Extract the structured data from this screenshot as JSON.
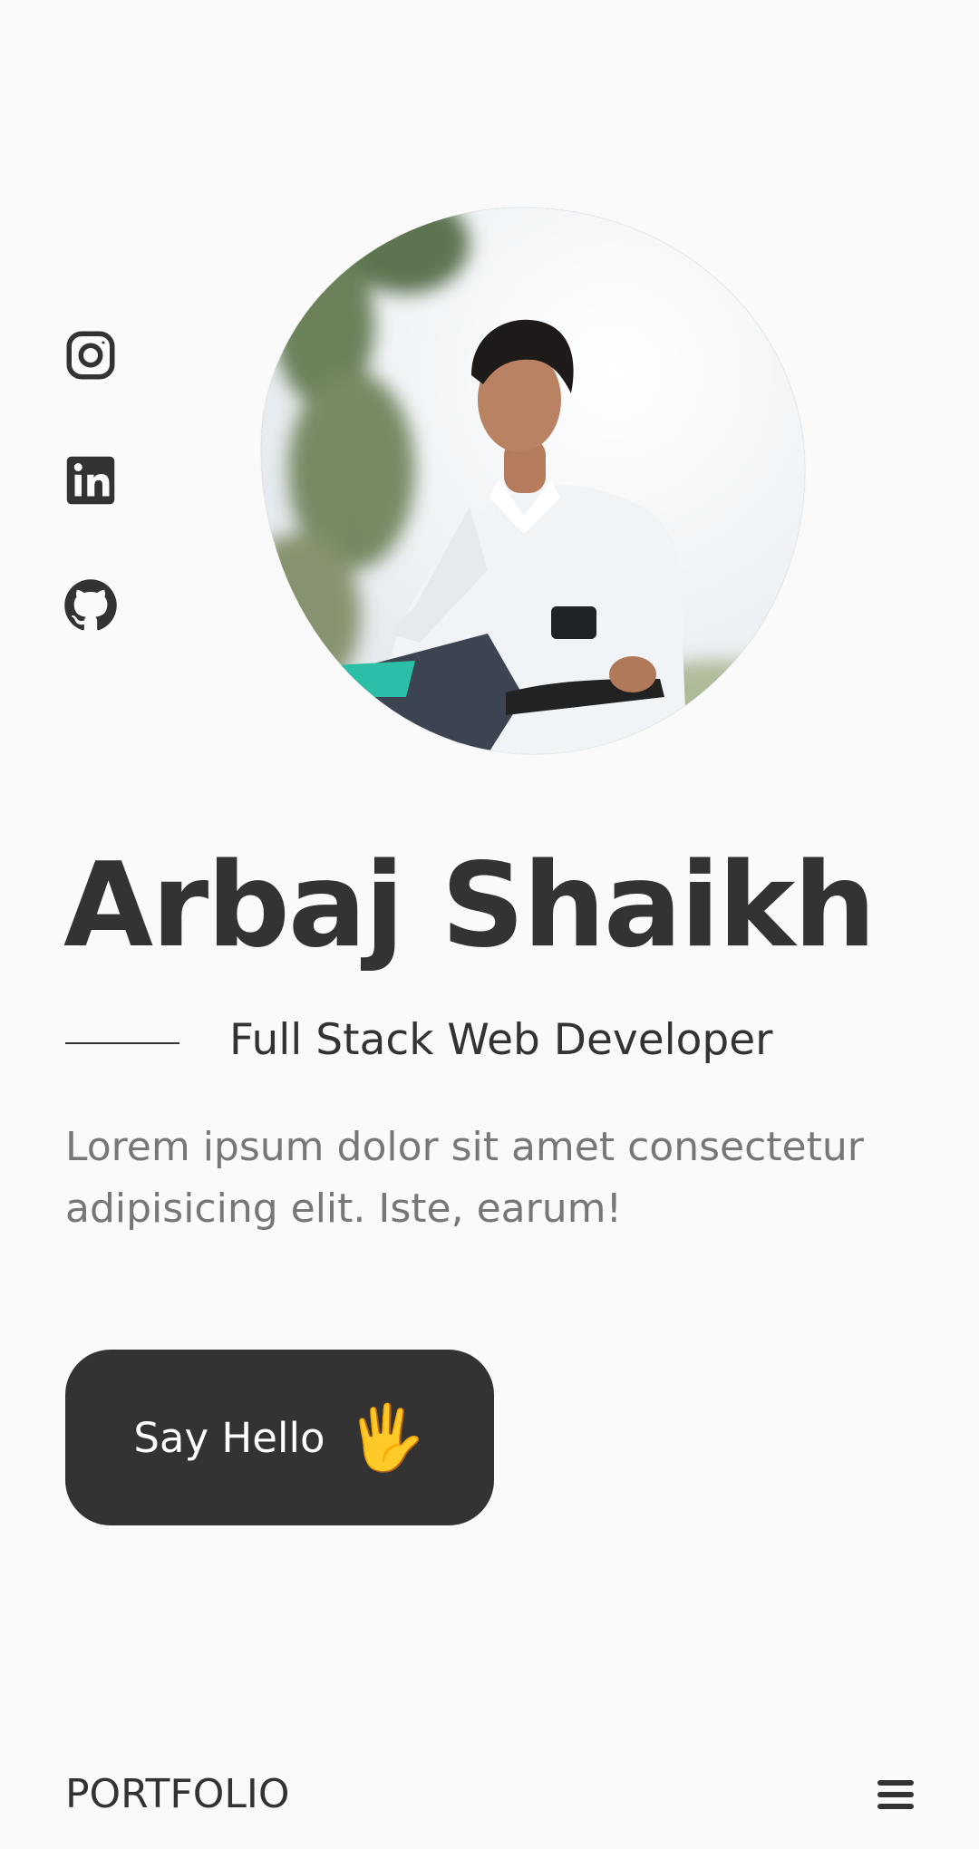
{
  "social": {
    "instagram_icon": "instagram-icon",
    "linkedin_icon": "linkedin-icon",
    "github_icon": "github-icon"
  },
  "home": {
    "name": "Arbaj Shaikh",
    "subtitle": "Full Stack Web Developer",
    "description": "Lorem ipsum dolor sit amet consectetur adipisicing elit. Iste, earum!",
    "button_label": "Say Hello",
    "button_emoji": "🖐"
  },
  "footer": {
    "logo": "PORTFOLIO",
    "menu_icon": "menu-icon"
  },
  "colors": {
    "background": "#fafafa",
    "text": "#333333",
    "muted_text": "#777777",
    "button_bg": "#333333",
    "button_text": "#ffffff"
  }
}
